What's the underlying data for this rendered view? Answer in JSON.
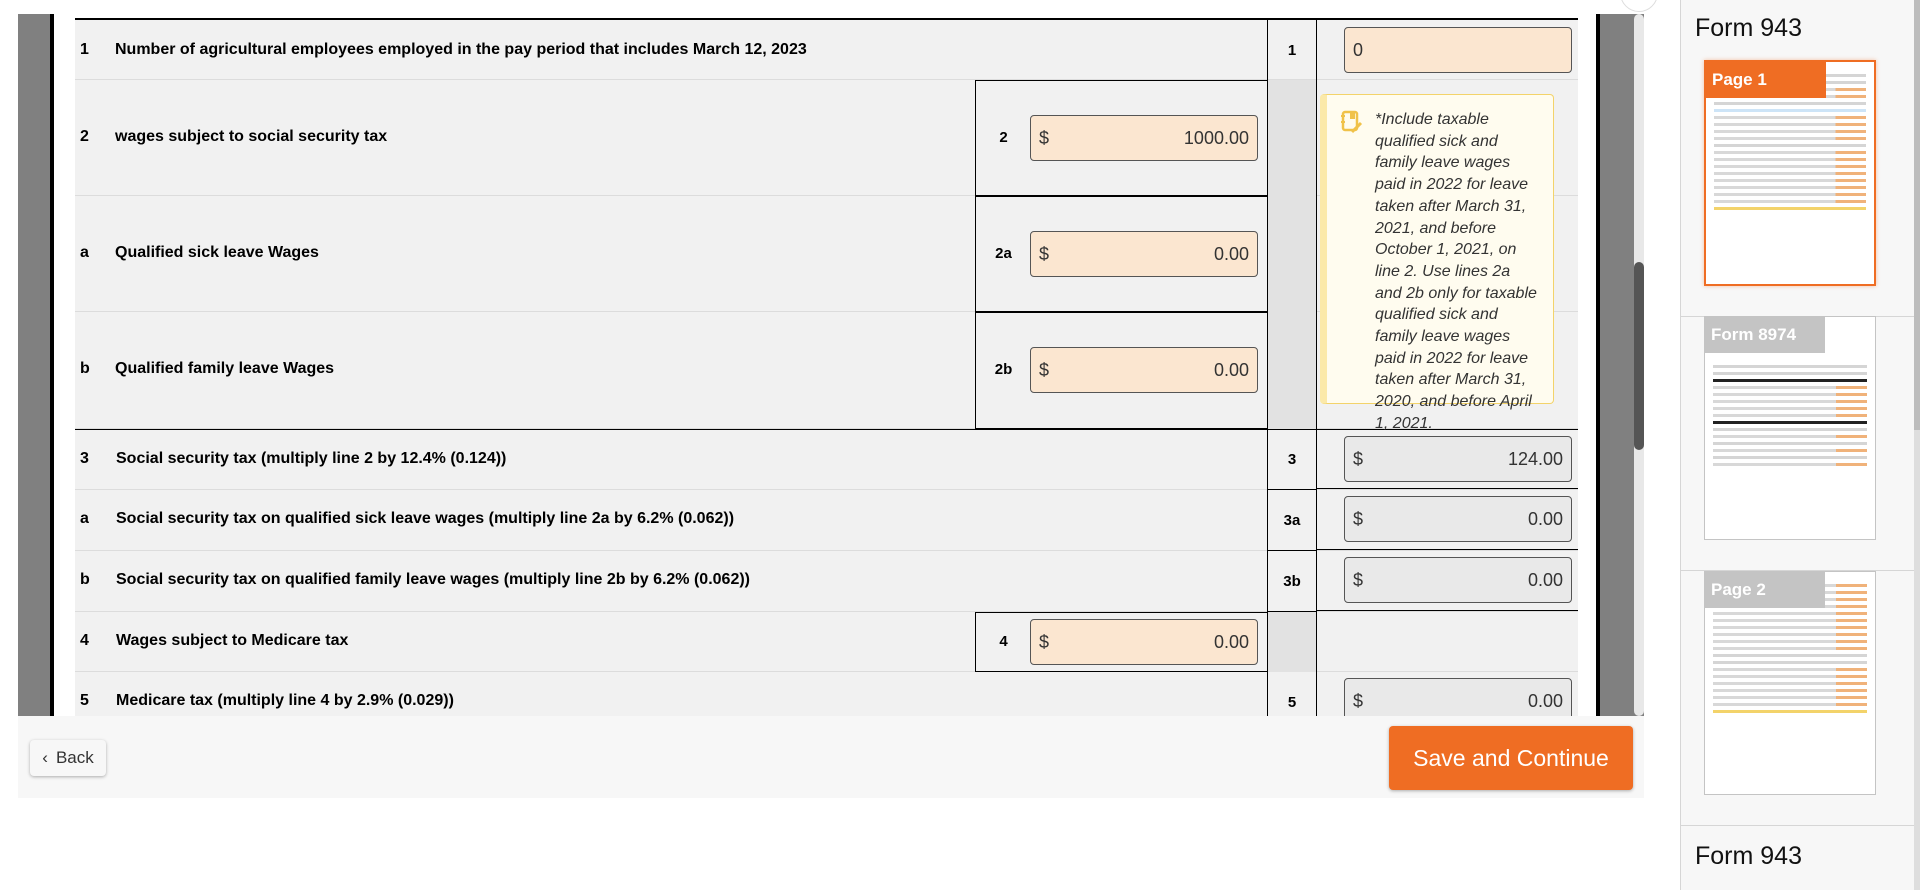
{
  "form_lines": [
    {
      "num": "1",
      "desc": "Number of agricultural employees employed in the pay period that includes March 12, 2023",
      "line": "1",
      "value": "0"
    },
    {
      "num": "2",
      "desc": "wages subject to social security tax",
      "line": "2",
      "currency": "$",
      "value": "1000.00"
    },
    {
      "num": "a",
      "desc": "Qualified sick leave Wages",
      "line": "2a",
      "currency": "$",
      "value": "0.00"
    },
    {
      "num": "b",
      "desc": "Qualified family leave Wages",
      "line": "2b",
      "currency": "$",
      "value": "0.00"
    },
    {
      "num": "3",
      "desc": "Social security tax (multiply line 2 by 12.4% (0.124))",
      "line": "3",
      "currency": "$",
      "value": "124.00"
    },
    {
      "num": "a",
      "desc": "Social security tax on qualified sick leave wages (multiply line 2a by 6.2% (0.062))",
      "line": "3a",
      "currency": "$",
      "value": "0.00"
    },
    {
      "num": "b",
      "desc": "Social security tax on qualified family leave wages (multiply line 2b by 6.2% (0.062))",
      "line": "3b",
      "currency": "$",
      "value": "0.00"
    },
    {
      "num": "4",
      "desc": "Wages subject to Medicare tax",
      "line": "4",
      "currency": "$",
      "value": "0.00"
    },
    {
      "num": "5",
      "desc": "Medicare tax (multiply line 4 by 2.9% (0.029))",
      "line": "5",
      "currency": "$",
      "value": "0.00"
    }
  ],
  "note": {
    "icon": "notebook-pencil-icon",
    "text": "*Include taxable qualified sick and family leave wages paid in 2022 for leave taken after March 31, 2021, and before October 1, 2021, on line 2. Use lines 2a and 2b only for taxable qualified sick and family leave wages paid in 2022 for leave taken after March 31, 2020, and before April 1, 2021."
  },
  "footer": {
    "back_label": "Back",
    "save_label": "Save and Continue"
  },
  "colors": {
    "accent": "#ef6d23",
    "input_fill": "#fbe6d0",
    "note_bg": "#fffcef"
  },
  "sidebar": {
    "sections": [
      {
        "title": "Form 943",
        "thumbnails": [
          {
            "label": "Page 1",
            "active": true
          }
        ]
      },
      {
        "title": "",
        "thumbnails": [
          {
            "label": "Form 8974",
            "active": false
          },
          {
            "label": "Page 2",
            "active": false
          }
        ]
      },
      {
        "title": "Form 943",
        "thumbnails": []
      }
    ]
  }
}
